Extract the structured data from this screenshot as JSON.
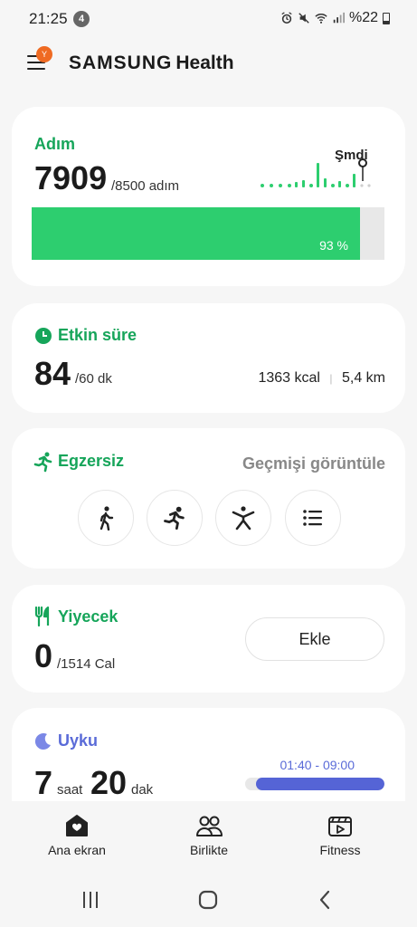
{
  "status": {
    "time": "21:25",
    "notif_count": "4",
    "battery": "%22"
  },
  "header": {
    "menu_badge": "Y",
    "brand": "SAMSUNG",
    "brand_suffix": "Health"
  },
  "steps": {
    "title": "Adım",
    "value": "7909",
    "target": "/8500 adım",
    "progress_label": "93 %",
    "progress": 0.93,
    "now_label": "Şmdi"
  },
  "active": {
    "title": "Etkin süre",
    "value": "84",
    "target": "/60 dk",
    "kcal": "1363 kcal",
    "distance": "5,4 km"
  },
  "exercise": {
    "title": "Egzersiz",
    "history": "Geçmişi görüntüle",
    "buttons": [
      "walk-icon",
      "run-icon",
      "workout-icon",
      "list-icon"
    ]
  },
  "food": {
    "title": "Yiyecek",
    "value": "0",
    "target": "/1514 Cal",
    "add": "Ekle"
  },
  "sleep": {
    "title": "Uyku",
    "hours": "7",
    "hours_unit": "saat",
    "minutes": "20",
    "minutes_unit": "dak",
    "range": "01:40 - 09:00"
  },
  "nav": {
    "home": "Ana ekran",
    "together": "Birlikte",
    "fitness": "Fitness"
  },
  "colors": {
    "accent": "#16a55a",
    "steps_fill": "#2dce6f",
    "sleep": "#5564d6",
    "badge": "#ef6a22"
  }
}
